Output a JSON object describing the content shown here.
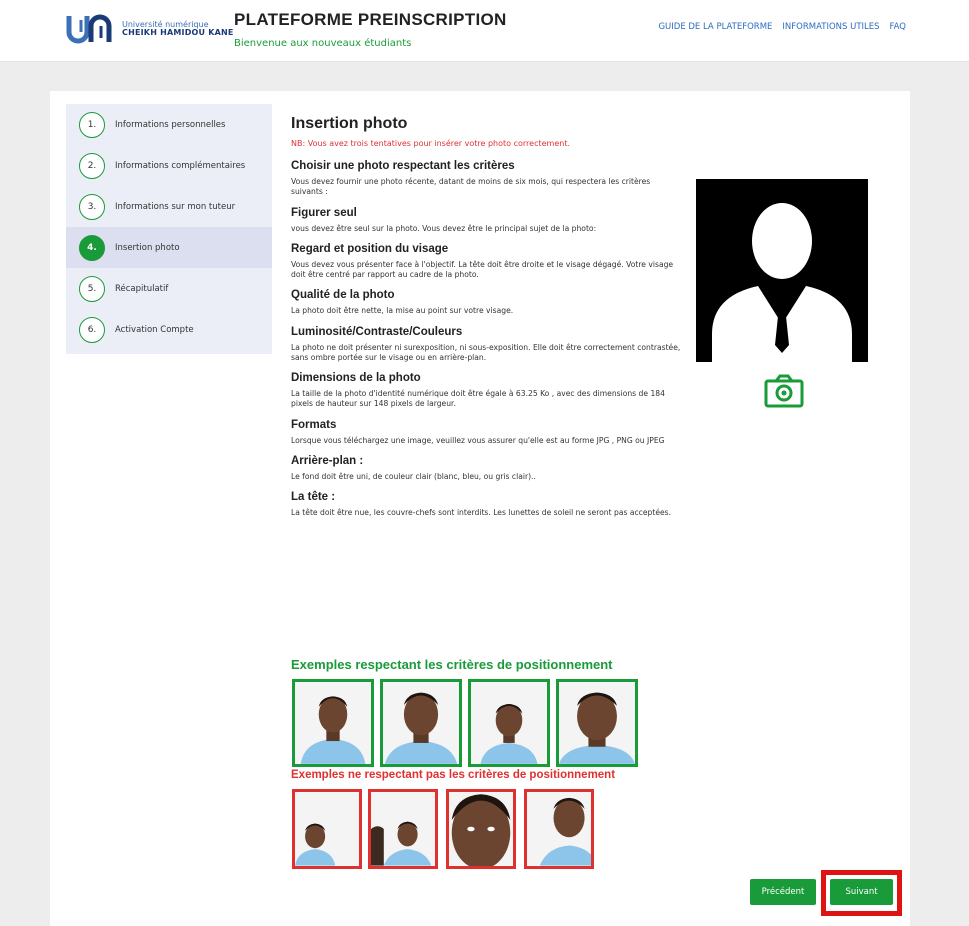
{
  "header": {
    "logo_line1": "Université numérique",
    "logo_line2": "CHEIKH HAMIDOU KANE",
    "title": "PLATEFORME PREINSCRIPTION",
    "subtitle": "Bienvenue aux nouveaux étudiants",
    "nav": [
      "GUIDE DE LA PLATEFORME",
      "INFORMATIONS UTILES",
      "FAQ"
    ]
  },
  "steps": [
    {
      "num": "1.",
      "label": "Informations personnelles",
      "active": false
    },
    {
      "num": "2.",
      "label": "Informations complémentaires",
      "active": false
    },
    {
      "num": "3.",
      "label": "Informations sur mon tuteur",
      "active": false
    },
    {
      "num": "4.",
      "label": "Insertion photo",
      "active": true
    },
    {
      "num": "5.",
      "label": "Récapitulatif",
      "active": false
    },
    {
      "num": "6.",
      "label": "Activation Compte",
      "active": false
    }
  ],
  "content": {
    "title": "Insertion photo",
    "nb": "NB: Vous avez trois tentatives pour insérer votre photo correctement.",
    "sections": [
      {
        "heading": "Choisir une photo respectant les critères",
        "text": "Vous devez fournir une photo récente, datant de moins de six mois, qui respectera les critères suivants :"
      },
      {
        "heading": "Figurer seul",
        "text": "vous devez être seul sur la photo. Vous devez être le principal sujet de la photo:"
      },
      {
        "heading": "Regard et position du visage",
        "text": "Vous devez vous présenter face à l'objectif. La tête doit être droite et le visage dégagé. Votre visage doit être centré par rapport au cadre de la photo."
      },
      {
        "heading": "Qualité de la photo",
        "text": "La photo doit être nette, la mise au point sur votre visage."
      },
      {
        "heading": "Luminosité/Contraste/Couleurs",
        "text": "La photo ne doit présenter ni surexposition, ni sous-exposition. Elle doit être correctement contrastée, sans ombre portée sur le visage ou en arrière-plan."
      },
      {
        "heading": "Dimensions de la photo",
        "text": "La taille de la photo d'identité numérique doit être égale à 63.25 Ko , avec des dimensions de 184 pixels de hauteur sur 148 pixels de largeur."
      },
      {
        "heading": "Formats",
        "text": "Lorsque vous téléchargez une image, veuillez vous assurer qu'elle est au forme JPG , PNG ou JPEG"
      },
      {
        "heading": "Arrière-plan :",
        "text": "Le fond doit être uni, de couleur clair (blanc, bleu, ou gris clair).."
      },
      {
        "heading": "La tête :",
        "text": "La tête doit être nue, les couvre-chefs sont interdits. Les lunettes de soleil ne seront pas acceptées."
      }
    ],
    "examples_ok_title": "Exemples respectant les critères de positionnement",
    "examples_bad_title": "Exemples ne respectant pas les critères de positionnement"
  },
  "buttons": {
    "prev": "Précédent",
    "next": "Suivant"
  },
  "colors": {
    "accent_green": "#1a9b3a",
    "alert_red": "#e03131",
    "nav_blue": "#2d6cc0"
  }
}
